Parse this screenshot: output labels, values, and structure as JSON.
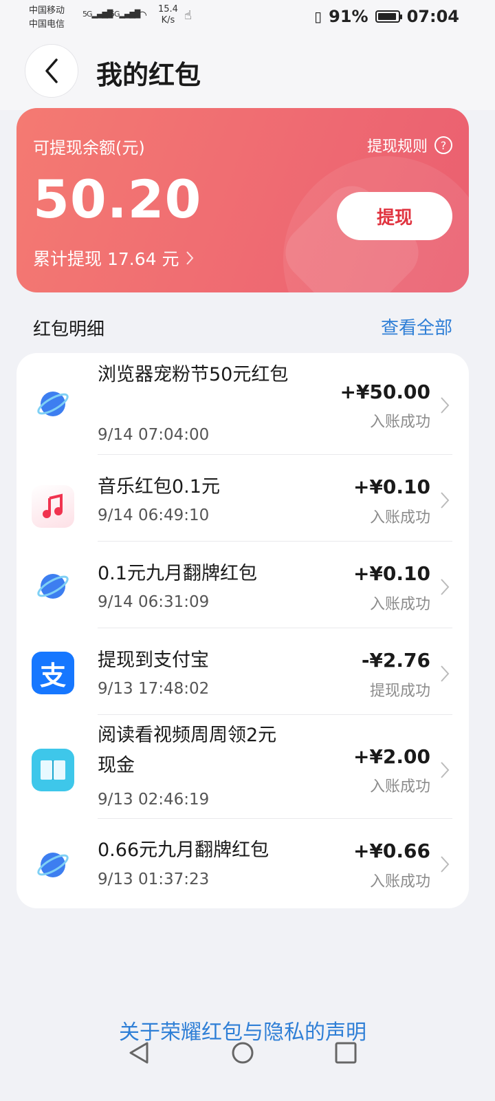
{
  "status_bar": {
    "carrier1": "中国移动",
    "carrier2": "中国电信",
    "net_speed_value": "15.4",
    "net_speed_unit": "K/s",
    "battery": "91%",
    "time": "07:04"
  },
  "header": {
    "title": "我的红包"
  },
  "balance": {
    "label": "可提现余额(元)",
    "amount": "50.20",
    "total_withdraw": "累计提现 17.64 元",
    "rules_label": "提现规则",
    "withdraw_button": "提现"
  },
  "detail_section": {
    "title": "红包明细",
    "view_all": "查看全部"
  },
  "transactions": [
    {
      "title": "浏览器宠粉节50元红包",
      "time": "9/14 07:04:00",
      "amount": "+¥50.00",
      "status": "入账成功",
      "icon": "browser-planet-icon"
    },
    {
      "title": "音乐红包0.1元",
      "time": "9/14 06:49:10",
      "amount": "+¥0.10",
      "status": "入账成功",
      "icon": "music-note-icon"
    },
    {
      "title": "0.1元九月翻牌红包",
      "time": "9/14 06:31:09",
      "amount": "+¥0.10",
      "status": "入账成功",
      "icon": "browser-planet-icon"
    },
    {
      "title": "提现到支付宝",
      "time": "9/13 17:48:02",
      "amount": "-¥2.76",
      "status": "提现成功",
      "icon": "alipay-icon"
    },
    {
      "title": "阅读看视频周周领2元现金",
      "time": "9/13 02:46:19",
      "amount": "+¥2.00",
      "status": "入账成功",
      "icon": "book-icon"
    },
    {
      "title": "0.66元九月翻牌红包",
      "time": "9/13 01:37:23",
      "amount": "+¥0.66",
      "status": "入账成功",
      "icon": "browser-planet-icon"
    }
  ],
  "footer": {
    "privacy_link": "关于荣耀红包与隐私的声明"
  },
  "colors": {
    "card_gradient_start": "#f47a72",
    "card_gradient_end": "#ea5f70",
    "link_blue": "#2f7fd6",
    "withdraw_text": "#e0333f"
  }
}
